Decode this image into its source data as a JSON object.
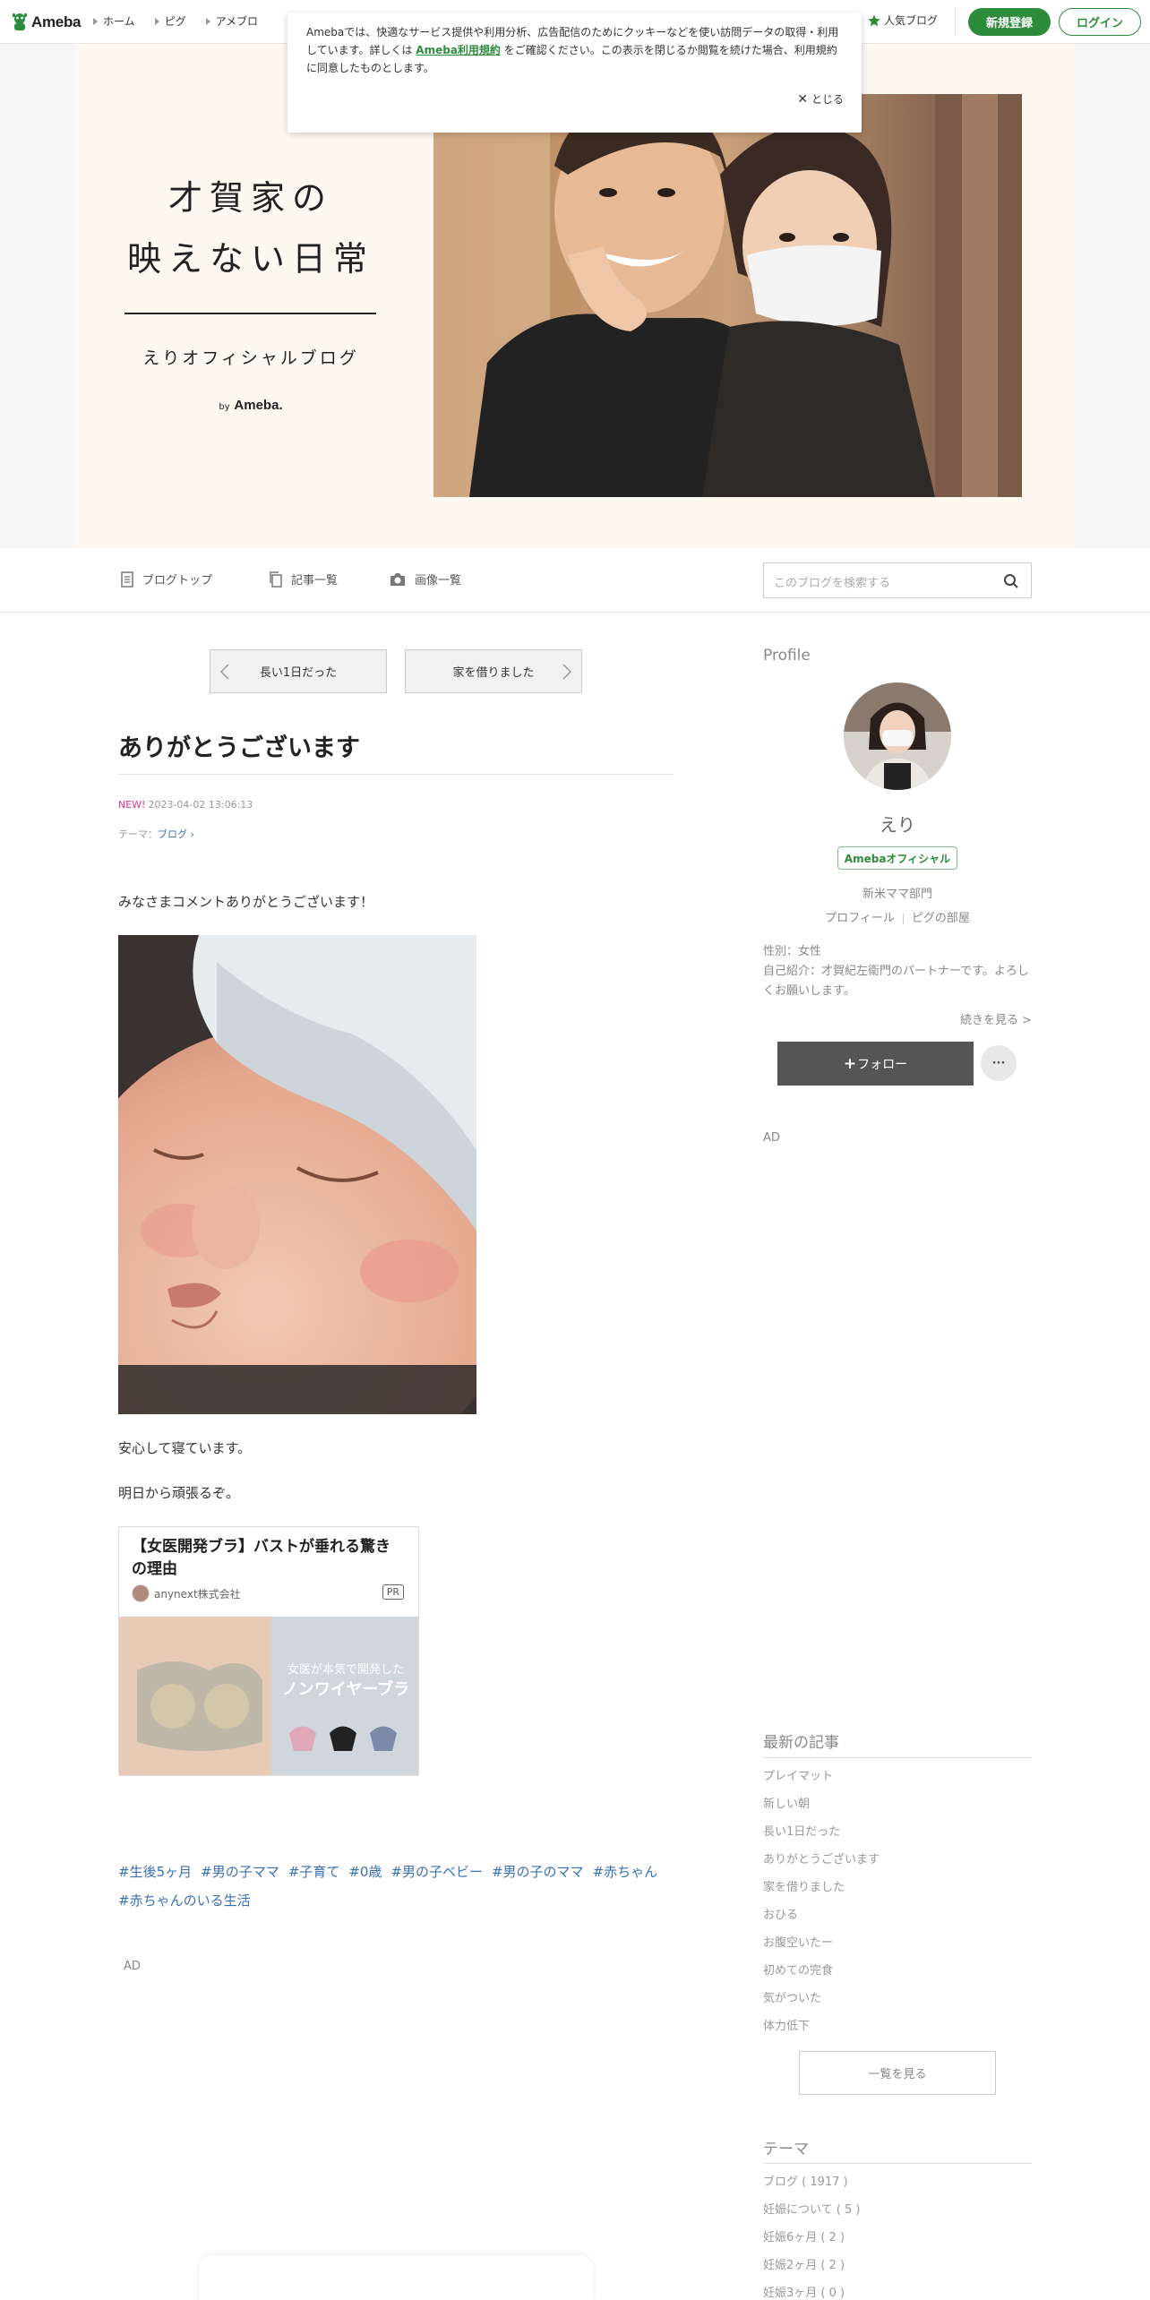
{
  "topnav": {
    "brand": "Ameba",
    "links": [
      "ホーム",
      "ピグ",
      "アメブロ"
    ],
    "popular": "人気ブログ",
    "signup": "新規登録",
    "login": "ログイン"
  },
  "cookie": {
    "text_before": "Amebaでは、快適なサービス提供や利用分析、広告配信のためにクッキーなどを使い訪問データの取得・利用しています。詳しくは",
    "link": "Ameba利用規約",
    "text_after": "をご確認ください。この表示を閉じるか閲覧を続けた場合、利用規約に同意したものとします。",
    "close": "とじる"
  },
  "header": {
    "title_line1": "才賀家の",
    "title_line2": "映えない日常",
    "subtitle": "えりオフィシャルブログ",
    "by": "by",
    "by_brand": "Ameba."
  },
  "subnav": {
    "blog_top": "ブログトップ",
    "entries": "記事一覧",
    "images": "画像一覧",
    "search_placeholder": "このブログを検索する"
  },
  "pager": {
    "prev": "長い1日だった",
    "next": "家を借りました"
  },
  "article": {
    "title": "ありがとうございます",
    "new_badge": "NEW!",
    "date": "2023-04-02 13:06:13",
    "theme_label": "テーマ：",
    "theme": "ブログ",
    "p1": "みなさまコメントありがとうございます！",
    "p2": "安心して寝ています。",
    "p3": "明日から頑張るぞ。",
    "hashtags": [
      "#生後5ヶ月",
      "#男の子ママ",
      "#子育て",
      "#0歳",
      "#男の子ベビー",
      "#男の子のママ",
      "#赤ちゃん",
      "#赤ちゃんのいる生活"
    ],
    "ad_label": "AD"
  },
  "adcard": {
    "title": "【女医開発ブラ】バストが垂れる驚きの理由",
    "advertiser": "anynext株式会社",
    "pr": "PR",
    "img_text1": "女医が本気で開発した",
    "img_text2": "ノンワイヤーブラ"
  },
  "sidebar": {
    "profile_heading": "Profile",
    "name": "えり",
    "official": "Amebaオフィシャル",
    "rank": "新米ママ部門",
    "link_profile": "プロフィール",
    "link_pig": "ピグの部屋",
    "bio": "性別：女性\n自己紹介：才賀紀左衛門のパートナーです。よろしくお願いします。",
    "more": "続きを見る >",
    "follow": "フォロー",
    "follow_plus": "+",
    "dots": "···",
    "ad_label": "AD",
    "recent_heading": "最新の記事",
    "recent": [
      "プレイマット",
      "新しい朝",
      "長い1日だった",
      "ありがとうございます",
      "家を借りました",
      "おひる",
      "お腹空いたー",
      "初めての完食",
      "気がついた",
      "体力低下"
    ],
    "list_button": "一覧を見る",
    "theme_heading": "テーマ",
    "themes": [
      "ブログ ( 1917 )",
      "妊娠について ( 5 )",
      "妊娠6ヶ月 ( 2 )",
      "妊娠2ヶ月 ( 2 )",
      "妊娠3ヶ月 ( 0 )"
    ]
  },
  "colors": {
    "brand_green": "#2d8c3c",
    "new_pink": "#e5338a",
    "link_blue": "#3a6fb5"
  }
}
